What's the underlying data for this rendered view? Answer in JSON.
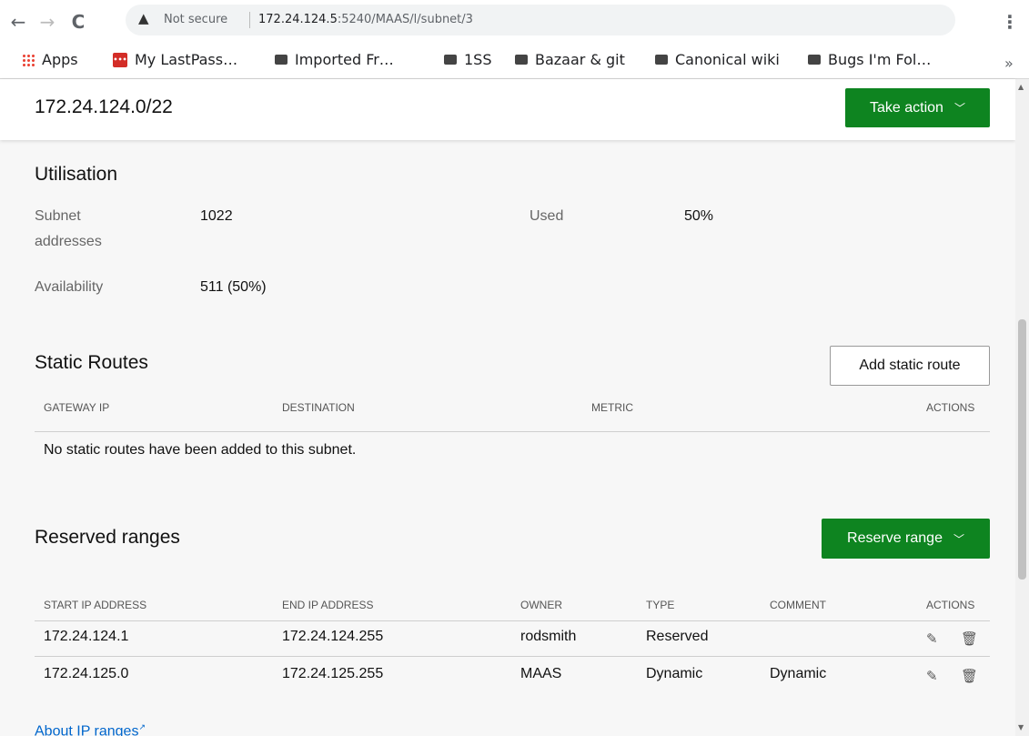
{
  "browser": {
    "back": "←",
    "forward": "→",
    "reload": "C",
    "not_secure": "Not secure",
    "url_host": "172.24.124.5",
    "url_rest": ":5240/MAAS/l/subnet/3",
    "bookmarks": [
      "Apps",
      "My LastPass…",
      "Imported Fr…",
      "1SS",
      "Bazaar & git",
      "Canonical wiki",
      "Bugs I'm Fol…"
    ],
    "more": "»"
  },
  "header": {
    "title": "172.24.124.0/22",
    "take_action": "Take action"
  },
  "utilisation": {
    "title": "Utilisation",
    "subnet_addresses_label": "Subnet addresses",
    "subnet_addresses_label_1": "Subnet",
    "subnet_addresses_label_2": "addresses",
    "subnet_addresses": "1022",
    "used_label": "Used",
    "used": "50%",
    "availability_label": "Availability",
    "availability": "511 (50%)"
  },
  "static_routes": {
    "title": "Static Routes",
    "add_button": "Add static route",
    "columns": [
      "Gateway IP",
      "Destination",
      "Metric",
      "Actions"
    ],
    "empty": "No static routes have been added to this subnet."
  },
  "reserved": {
    "title": "Reserved ranges",
    "reserve_button": "Reserve range",
    "columns": [
      "Start IP address",
      "End IP address",
      "Owner",
      "Type",
      "Comment",
      "Actions"
    ],
    "rows": [
      {
        "start": "172.24.124.1",
        "end": "172.24.124.255",
        "owner": "rodsmith",
        "type": "Reserved",
        "comment": ""
      },
      {
        "start": "172.24.125.0",
        "end": "172.24.125.255",
        "owner": "MAAS",
        "type": "Dynamic",
        "comment": "Dynamic"
      }
    ],
    "about_link": "About IP ranges"
  }
}
